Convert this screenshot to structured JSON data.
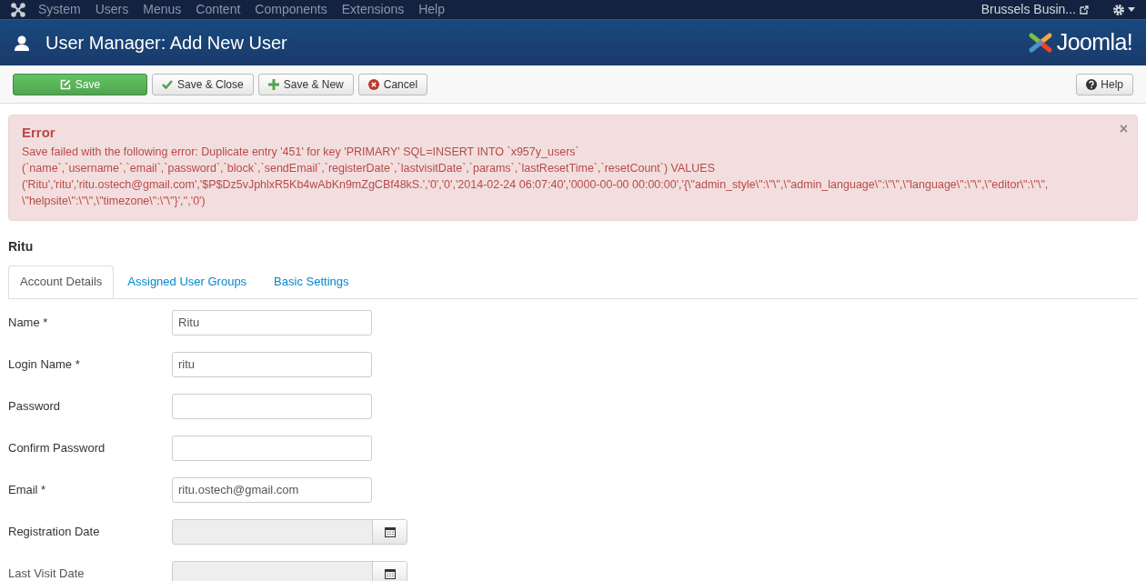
{
  "top_menu": {
    "items": [
      "System",
      "Users",
      "Menus",
      "Content",
      "Components",
      "Extensions",
      "Help"
    ],
    "site_link": "Brussels Busin..."
  },
  "header": {
    "title": "User Manager: Add New User",
    "logo_text": "Joomla!"
  },
  "toolbar": {
    "buttons": [
      {
        "label": "Save",
        "kind": "save"
      },
      {
        "label": "Save & Close",
        "kind": "save_close"
      },
      {
        "label": "Save & New",
        "kind": "save_new"
      },
      {
        "label": "Cancel",
        "kind": "cancel"
      }
    ],
    "help_button": "Help"
  },
  "alert": {
    "title": "Error",
    "close": "×",
    "message": "Save failed with the following error: Duplicate entry '451' for key 'PRIMARY' SQL=INSERT INTO `x957y_users`\n(`name`,`username`,`email`,`password`,`block`,`sendEmail`,`registerDate`,`lastvisitDate`,`params`,`lastResetTime`,`resetCount`) VALUES\n('Ritu','ritu','ritu.ostech@gmail.com','$P$Dz5vJphlxR5Kb4wAbKn9mZgCBf48kS.','0','0','2014-02-24 06:07:40','0000-00-00 00:00:00','{\\\"admin_style\\\":\\\"\\\",\\\"admin_language\\\":\\\"\\\",\\\"language\\\":\\\"\\\",\\\"editor\\\":\\\"\\\",\n\\\"helpsite\\\":\\\"\\\",\\\"timezone\\\":\\\"\\\"}','','0')"
  },
  "form_title": "Ritu",
  "tabs": [
    {
      "label": "Account Details",
      "selected": true
    },
    {
      "label": "Assigned User Groups",
      "selected": false
    },
    {
      "label": "Basic Settings",
      "selected": false
    }
  ],
  "fields": [
    {
      "label": "Name *",
      "kind": "text",
      "value": "Ritu",
      "disabled": false
    },
    {
      "label": "Login Name *",
      "kind": "text",
      "value": "ritu",
      "disabled": false
    },
    {
      "label": "Password",
      "kind": "text",
      "disabled": false
    },
    {
      "label": "Confirm Password",
      "kind": "text",
      "disabled": false
    },
    {
      "label": "Email *",
      "kind": "text",
      "value": "ritu.ostech@gmail.com",
      "disabled": false
    },
    {
      "label": "Registration Date",
      "kind": "date",
      "disabled": true
    },
    {
      "label": "Last Visit Date",
      "kind": "date",
      "disabled": true
    }
  ]
}
